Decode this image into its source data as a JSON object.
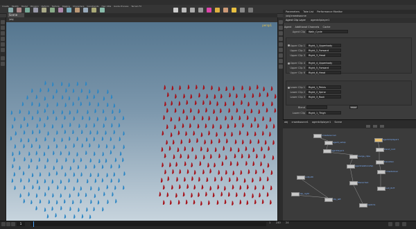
{
  "window": {
    "menu": [
      "File",
      "Edit",
      "Render",
      "Assets",
      "Windows",
      "Help"
    ]
  },
  "shelf": {
    "tabs": [
      "Create",
      "Modify",
      "Model",
      "Polygon",
      "Deform",
      "Texture",
      "Rigging",
      "Characters",
      "Constraints",
      "Hair Utils",
      "Guide Process",
      "Terrain FX"
    ]
  },
  "viewport": {
    "tab_label": "Scene View",
    "path": "/obj",
    "camera_label": "persp1",
    "crowd_left_color": "#2d86c4",
    "crowd_right_color": "#a6131b"
  },
  "param_panel": {
    "tabs": [
      "Parameters",
      "Take List",
      "Performance Monitor"
    ],
    "path": "/obj/crowdsource",
    "node_type": "Agent Clip Layer",
    "node_name": "agentcliplayer1",
    "sub_tabs": [
      "Agent",
      "Additional Channels",
      "Cache"
    ],
    "agent_label": "Agent Clip",
    "agent_value": "Walk_Cycle",
    "upper_rows": [
      {
        "label": "Upper Clip 1",
        "value": "Right_1_Upperbody"
      },
      {
        "label": "Upper Clip 2",
        "value": "Right_2_Forward"
      },
      {
        "label": "Upper Clip 3",
        "value": "Right_3_Head"
      }
    ],
    "lower_rows": [
      {
        "label": "Upper Clip 4",
        "value": "Right_4_Upperbody"
      },
      {
        "label": "Upper Clip 5",
        "value": "Right_5_Forward"
      },
      {
        "label": "Upper Clip 6",
        "value": "Right_6_Head"
      }
    ],
    "blend_rows": [
      {
        "label": "Lower Clip 1",
        "value": "Right_1_Pelvis"
      },
      {
        "label": "Lower Clip 2",
        "value": "Right_2_Spine"
      },
      {
        "label": "Lower Clip 3",
        "value": "Right_3_Root"
      }
    ],
    "last_label": "Lower Clip",
    "last_value": "Right_1_Thigh",
    "blend_label": "Blend",
    "button_label": "Clear"
  },
  "network": {
    "tabs": [
      "obj",
      "crowdsource1",
      "agentcliplayer1",
      "Scene"
    ],
    "node_labels": [
      "crowdsource1",
      "agent_setup",
      "agentcliplayer1",
      "agentlayer1",
      "blend_root",
      "merge_clips",
      "transition",
      "agentrelationship",
      "crowdsolver",
      "output0",
      "filecache1",
      "null_OUT",
      "clip_right",
      "clip_left",
      "switch1"
    ]
  },
  "timeline": {
    "frame": "1",
    "start": "1",
    "end": "240",
    "fps_label": "24"
  }
}
